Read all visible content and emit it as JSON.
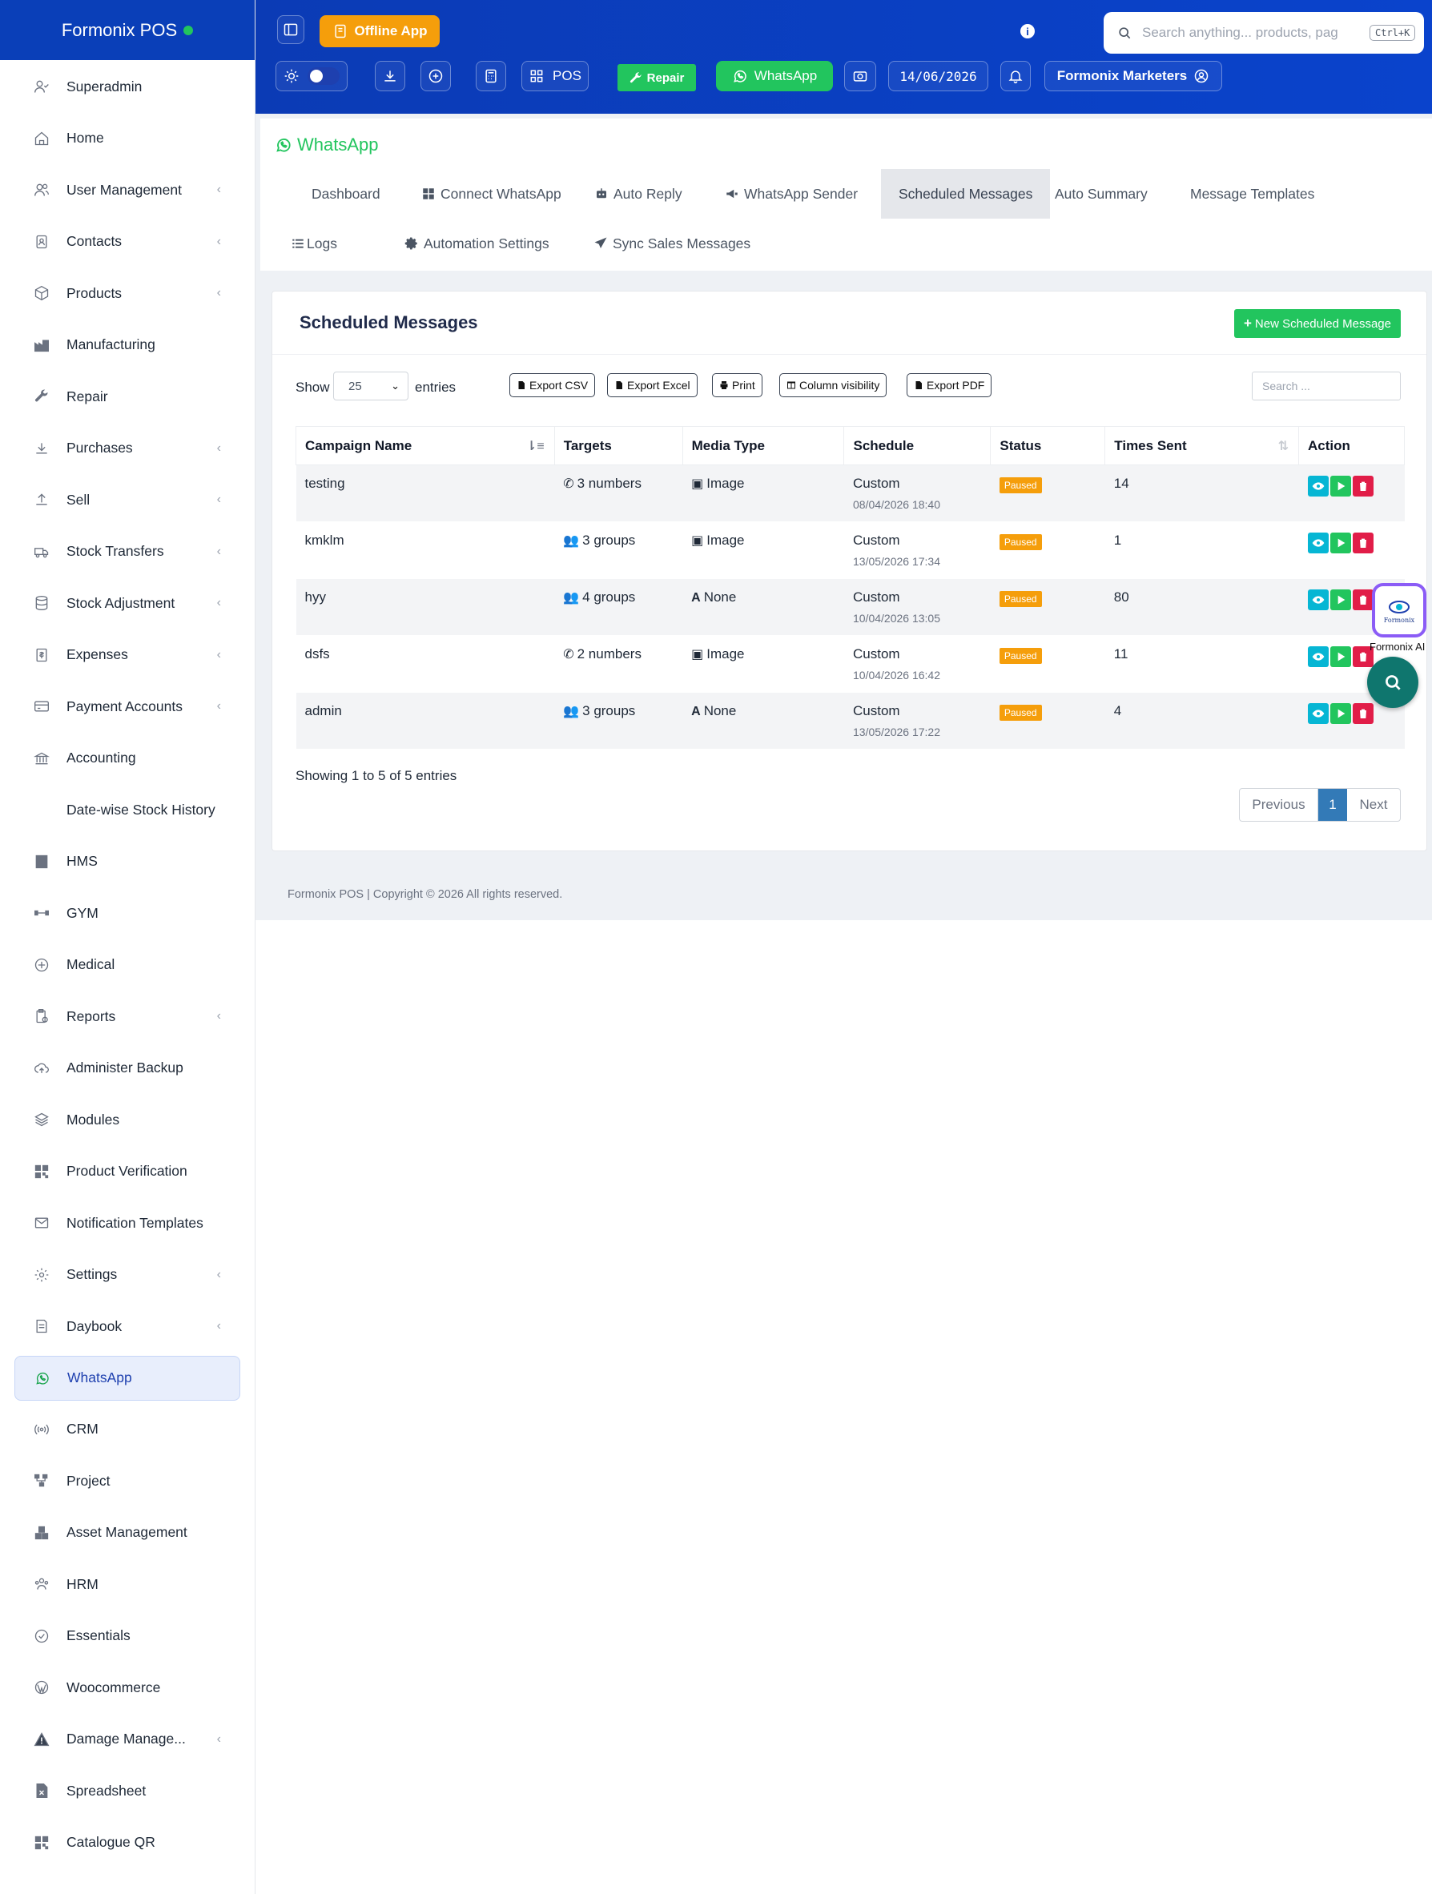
{
  "brand": {
    "name": "Formonix POS",
    "status_color": "#22c55e"
  },
  "sidebar": {
    "items": [
      {
        "label": "Superadmin",
        "icon": "user-check-icon",
        "chevron": false
      },
      {
        "label": "Home",
        "icon": "home-icon",
        "chevron": false
      },
      {
        "label": "User Management",
        "icon": "users-icon",
        "chevron": true
      },
      {
        "label": "Contacts",
        "icon": "address-book-icon",
        "chevron": true
      },
      {
        "label": "Products",
        "icon": "box-icon",
        "chevron": true
      },
      {
        "label": "Manufacturing",
        "icon": "factory-icon",
        "chevron": false
      },
      {
        "label": "Repair",
        "icon": "wrench-icon",
        "chevron": false
      },
      {
        "label": "Purchases",
        "icon": "download-icon",
        "chevron": true
      },
      {
        "label": "Sell",
        "icon": "upload-icon",
        "chevron": true
      },
      {
        "label": "Stock Transfers",
        "icon": "truck-icon",
        "chevron": true
      },
      {
        "label": "Stock Adjustment",
        "icon": "database-icon",
        "chevron": true
      },
      {
        "label": "Expenses",
        "icon": "receipt-icon",
        "chevron": true
      },
      {
        "label": "Payment Accounts",
        "icon": "credit-card-icon",
        "chevron": true
      },
      {
        "label": "Accounting",
        "icon": "bank-icon",
        "chevron": false
      },
      {
        "label": "Date-wise Stock History",
        "icon": "",
        "chevron": false
      },
      {
        "label": "HMS",
        "icon": "hotel-icon",
        "chevron": false
      },
      {
        "label": "GYM",
        "icon": "dumbbell-icon",
        "chevron": false
      },
      {
        "label": "Medical",
        "icon": "medical-icon",
        "chevron": false
      },
      {
        "label": "Reports",
        "icon": "report-icon",
        "chevron": true
      },
      {
        "label": "Administer Backup",
        "icon": "cloud-upload-icon",
        "chevron": false
      },
      {
        "label": "Modules",
        "icon": "layers-icon",
        "chevron": false
      },
      {
        "label": "Product Verification",
        "icon": "qr-icon",
        "chevron": false
      },
      {
        "label": "Notification Templates",
        "icon": "envelope-icon",
        "chevron": false
      },
      {
        "label": "Settings",
        "icon": "gear-icon",
        "chevron": true
      },
      {
        "label": "Daybook",
        "icon": "book-icon",
        "chevron": true
      },
      {
        "label": "WhatsApp",
        "icon": "whatsapp-icon",
        "chevron": false,
        "active": true
      },
      {
        "label": "CRM",
        "icon": "broadcast-icon",
        "chevron": false
      },
      {
        "label": "Project",
        "icon": "project-icon",
        "chevron": false
      },
      {
        "label": "Asset Management",
        "icon": "boxes-icon",
        "chevron": false
      },
      {
        "label": "HRM",
        "icon": "team-icon",
        "chevron": false
      },
      {
        "label": "Essentials",
        "icon": "check-circle-icon",
        "chevron": false
      },
      {
        "label": "Woocommerce",
        "icon": "wordpress-icon",
        "chevron": false
      },
      {
        "label": "Damage Manage...",
        "icon": "warning-icon",
        "chevron": true
      },
      {
        "label": "Spreadsheet",
        "icon": "spreadsheet-icon",
        "chevron": false
      },
      {
        "label": "Catalogue QR",
        "icon": "qr-icon",
        "chevron": false
      }
    ]
  },
  "topbar": {
    "offline_label": "Offline App",
    "pos_label": "POS",
    "repair_label": "Repair",
    "whatsapp_label": "WhatsApp",
    "date": "14/06/2026",
    "business_label": "Formonix Marketers",
    "search_placeholder": "Search anything... products, pag",
    "search_shortcut": "Ctrl+K"
  },
  "whatsapp": {
    "title": "WhatsApp",
    "tabs": [
      "Dashboard",
      "Connect WhatsApp",
      "Auto Reply",
      "WhatsApp Sender",
      "Scheduled Messages",
      "Auto Summary",
      "Message Templates",
      "Logs",
      "Automation Settings",
      "Sync Sales Messages"
    ],
    "active_tab": "Scheduled Messages"
  },
  "card": {
    "title": "Scheduled Messages",
    "new_button": "New Scheduled Message",
    "show_label": "Show",
    "entries_value": "25",
    "entries_label": "entries",
    "export_buttons": [
      "Export CSV",
      "Export Excel",
      "Print",
      "Column visibility",
      "Export PDF"
    ],
    "search_placeholder": "Search ...",
    "columns": [
      "Campaign Name",
      "Targets",
      "Media Type",
      "Schedule",
      "Status",
      "Times Sent",
      "Action"
    ],
    "rows": [
      {
        "name": "testing",
        "target_icon": "phone",
        "targets": "3 numbers",
        "media_icon": "image",
        "media": "Image",
        "schedule": "Custom",
        "schedule_time": "08/04/2026 18:40",
        "status": "Paused",
        "times_sent": "14"
      },
      {
        "name": "kmklm",
        "target_icon": "group",
        "targets": "3 groups",
        "media_icon": "image",
        "media": "Image",
        "schedule": "Custom",
        "schedule_time": "13/05/2026 17:34",
        "status": "Paused",
        "times_sent": "1"
      },
      {
        "name": "hyy",
        "target_icon": "group",
        "targets": "4 groups",
        "media_icon": "text",
        "media": "None",
        "schedule": "Custom",
        "schedule_time": "10/04/2026 13:05",
        "status": "Paused",
        "times_sent": "80"
      },
      {
        "name": "dsfs",
        "target_icon": "phone",
        "targets": "2 numbers",
        "media_icon": "image",
        "media": "Image",
        "schedule": "Custom",
        "schedule_time": "10/04/2026 16:42",
        "status": "Paused",
        "times_sent": "11"
      },
      {
        "name": "admin",
        "target_icon": "group",
        "targets": "3 groups",
        "media_icon": "text",
        "media": "None",
        "schedule": "Custom",
        "schedule_time": "13/05/2026 17:22",
        "status": "Paused",
        "times_sent": "4"
      }
    ],
    "showing_text": "Showing 1 to 5 of 5 entries",
    "pager": {
      "prev": "Previous",
      "current": "1",
      "next": "Next"
    }
  },
  "footer": "Formonix POS | Copyright © 2026 All rights reserved.",
  "assistant": {
    "logo_text": "Formonix",
    "label": "Formonix AI"
  }
}
